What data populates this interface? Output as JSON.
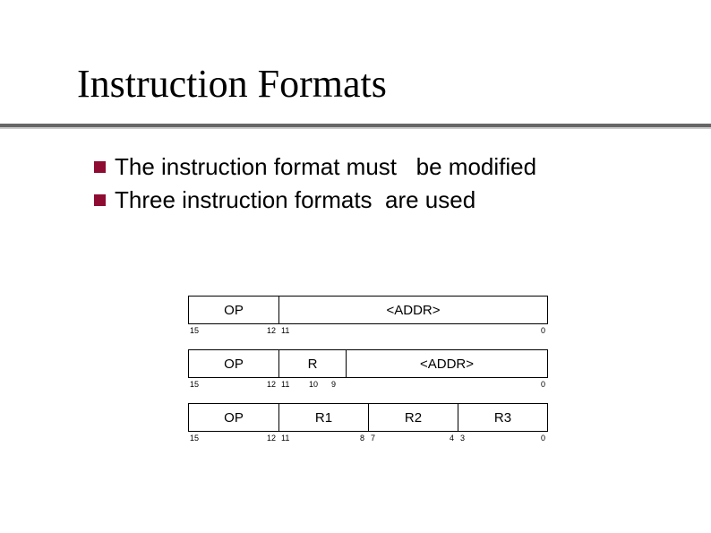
{
  "title": "Instruction Formats",
  "bullets": [
    "The instruction format must   be modified",
    "Three instruction formats  are used"
  ],
  "labels": {
    "op": "OP",
    "addr": "<ADDR>",
    "r": "R",
    "r1": "R1",
    "r2": "R2",
    "r3": "R3"
  },
  "bits": {
    "fmt1": {
      "b15": "15",
      "b12": "12",
      "b11": "11",
      "b0": "0"
    },
    "fmt2": {
      "b15": "15",
      "b12": "12",
      "b11": "11",
      "b10": "10",
      "b9": "9",
      "b0": "0"
    },
    "fmt3": {
      "b15": "15",
      "b12": "12",
      "b11": "11",
      "b8": "8",
      "b7": "7",
      "b4": "4",
      "b3": "3",
      "b0": "0"
    }
  }
}
